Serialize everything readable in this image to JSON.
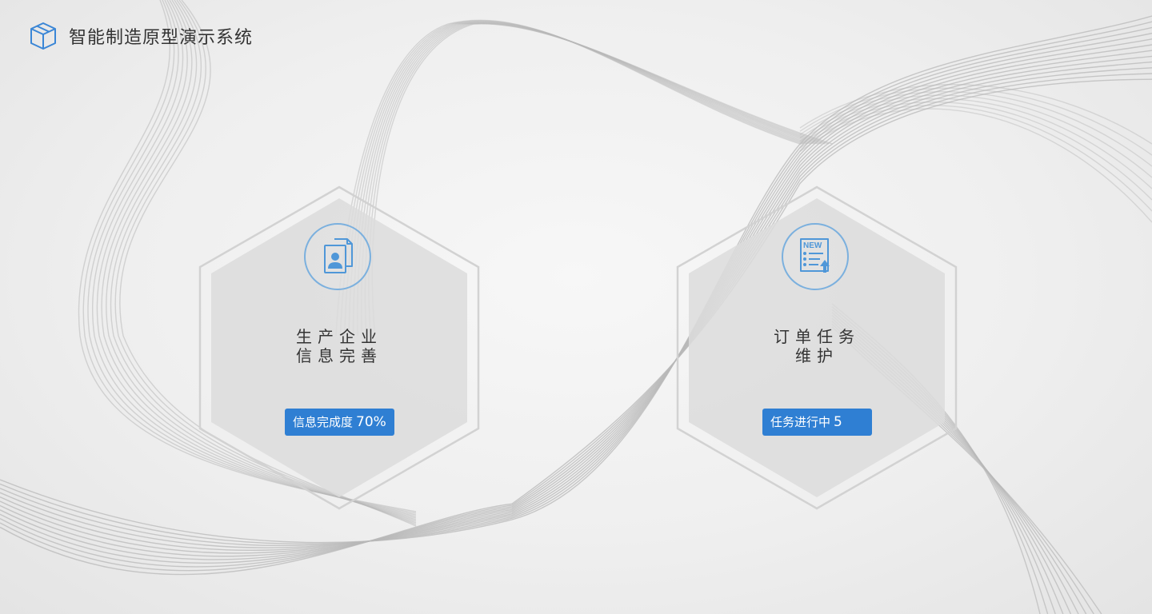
{
  "app": {
    "title": "智能制造原型演示系统"
  },
  "cards": [
    {
      "title_line1": "生产企业",
      "title_line2": "信息完善",
      "icon": "company-documents-icon",
      "badge_label": "信息完成度",
      "badge_value": "70%"
    },
    {
      "title_line1": "订单任务",
      "title_line2": "维护",
      "icon": "new-order-list-icon",
      "badge_label": "任务进行中",
      "badge_value": "5",
      "icon_text": "NEW"
    }
  ],
  "colors": {
    "accent": "#2f7fd3",
    "icon_stroke": "#5a9edb",
    "hex_fill": "#dcdcdc",
    "hex_border": "#d4d4d4"
  }
}
